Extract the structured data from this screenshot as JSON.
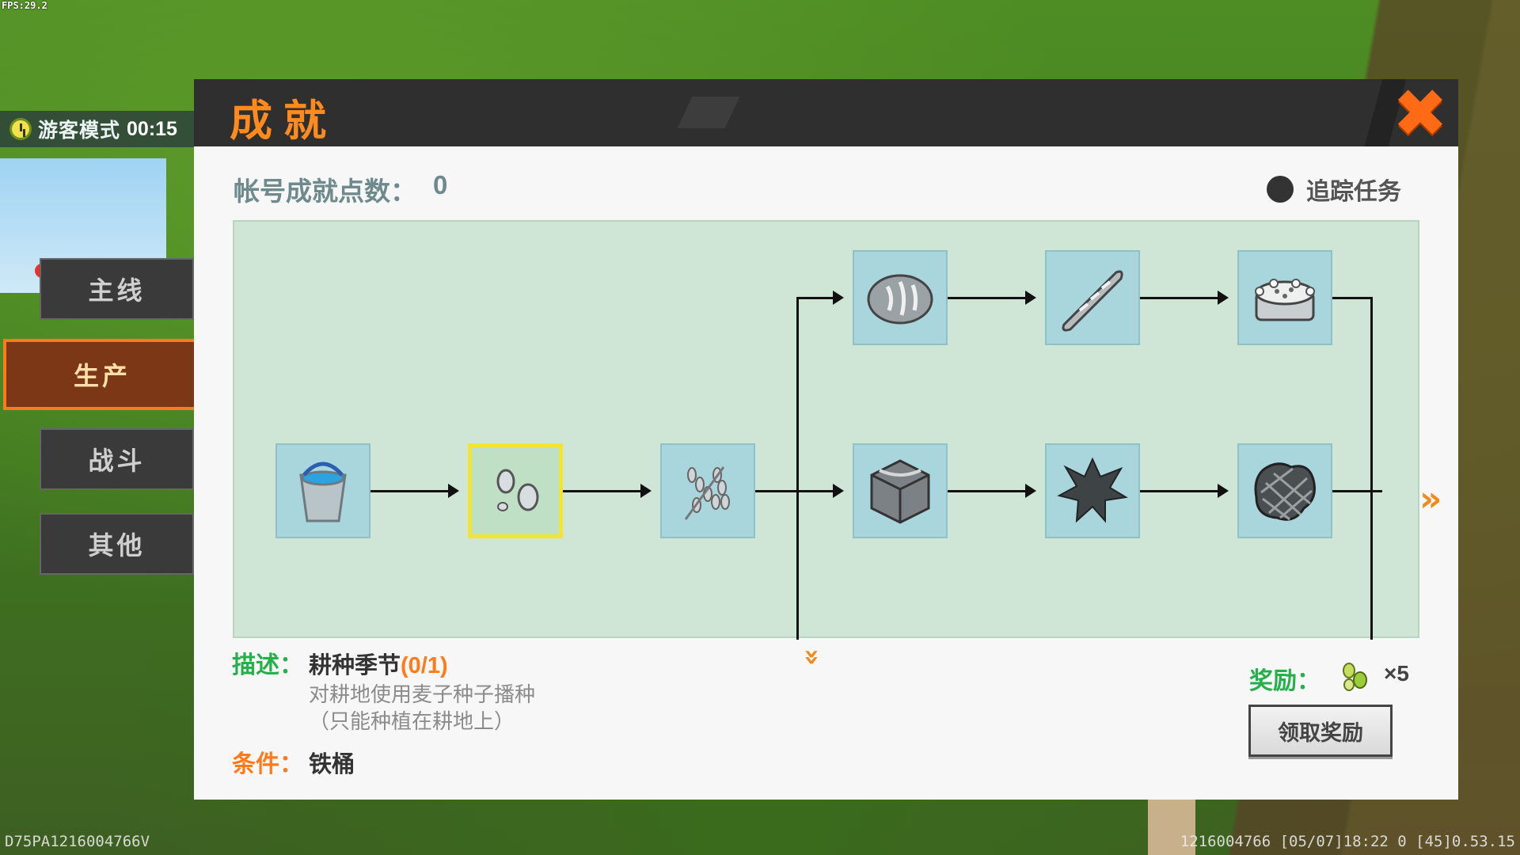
{
  "hud": {
    "fps": "FPS:29.2",
    "guest_mode": "游客模式",
    "guest_time": "00:15",
    "version": "D75PA1216004766V",
    "status_line": "1216004766   [05/07]18:22 0   [45]0.53.15"
  },
  "tabs": [
    {
      "label": "主线",
      "active": false,
      "has_dot": true
    },
    {
      "label": "生产",
      "active": true,
      "has_dot": false
    },
    {
      "label": "战斗",
      "active": false,
      "has_dot": false
    },
    {
      "label": "其他",
      "active": false,
      "has_dot": false
    }
  ],
  "panel": {
    "title": "成就",
    "points_label": "帐号成就点数：",
    "points_value": "0",
    "track_label": "追踪任务"
  },
  "nodes": [
    {
      "id": "iron-bucket",
      "icon": "iron-bucket-icon",
      "selected": false
    },
    {
      "id": "wheat-seeds",
      "icon": "wheat-seeds-icon",
      "selected": true
    },
    {
      "id": "wheat",
      "icon": "wheat-icon",
      "selected": false
    },
    {
      "id": "bread",
      "icon": "bread-icon",
      "selected": false
    },
    {
      "id": "baguette",
      "icon": "baguette-icon",
      "selected": false
    },
    {
      "id": "cake",
      "icon": "cake-icon",
      "selected": false
    },
    {
      "id": "stone-block",
      "icon": "stone-block-icon",
      "selected": false
    },
    {
      "id": "spiky-ore",
      "icon": "spiky-ore-icon",
      "selected": false
    },
    {
      "id": "grilled-steak",
      "icon": "grilled-steak-icon",
      "selected": false
    }
  ],
  "detail": {
    "desc_label": "描述：",
    "desc_title": "耕种季节",
    "desc_progress": "(0/1)",
    "desc_line1": "对耕地使用麦子种子播种",
    "desc_line2": "（只能种植在耕地上）",
    "cond_label": "条件：",
    "cond_value": "铁桶",
    "reward_label": "奖励：",
    "reward_icon": "green-beans-icon",
    "reward_count": "×5",
    "claim_label": "领取奖励"
  },
  "colors": {
    "accent_orange": "#ff7a1a",
    "label_green": "#25b04a",
    "tree_bg": "#cfe6d6",
    "node_bg": "#a9d5dc",
    "selected_border": "#f2e531"
  }
}
